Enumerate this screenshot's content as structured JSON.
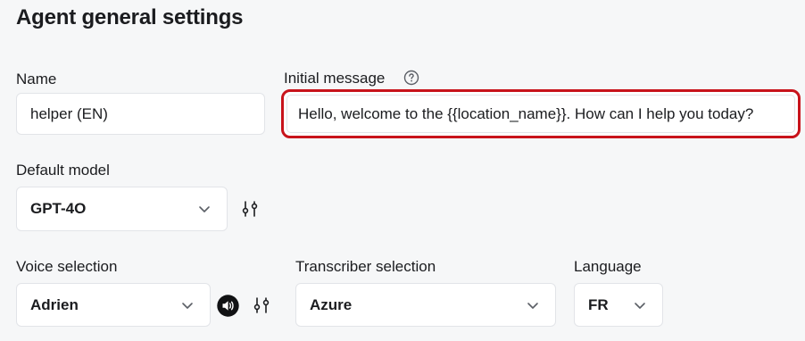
{
  "page": {
    "title": "Agent general settings"
  },
  "name_field": {
    "label": "Name",
    "value": "helper (EN)"
  },
  "initial_message": {
    "label": "Initial message",
    "value": "Hello, welcome to the {{location_name}}. How can I help you today?",
    "help_icon": "question-circle-icon",
    "highlight_color": "#c8131b"
  },
  "default_model": {
    "label": "Default model",
    "value": "GPT-4O",
    "settings_icon": "sliders-icon"
  },
  "voice_selection": {
    "label": "Voice selection",
    "value": "Adrien",
    "play_icon": "speaker-icon",
    "settings_icon": "sliders-icon"
  },
  "transcriber_selection": {
    "label": "Transcriber selection",
    "value": "Azure"
  },
  "language": {
    "label": "Language",
    "value": "FR"
  },
  "colors": {
    "background": "#f6f7f8",
    "text": "#1b1c1f",
    "border": "#e2e4e8",
    "accent_red": "#c8131b"
  }
}
